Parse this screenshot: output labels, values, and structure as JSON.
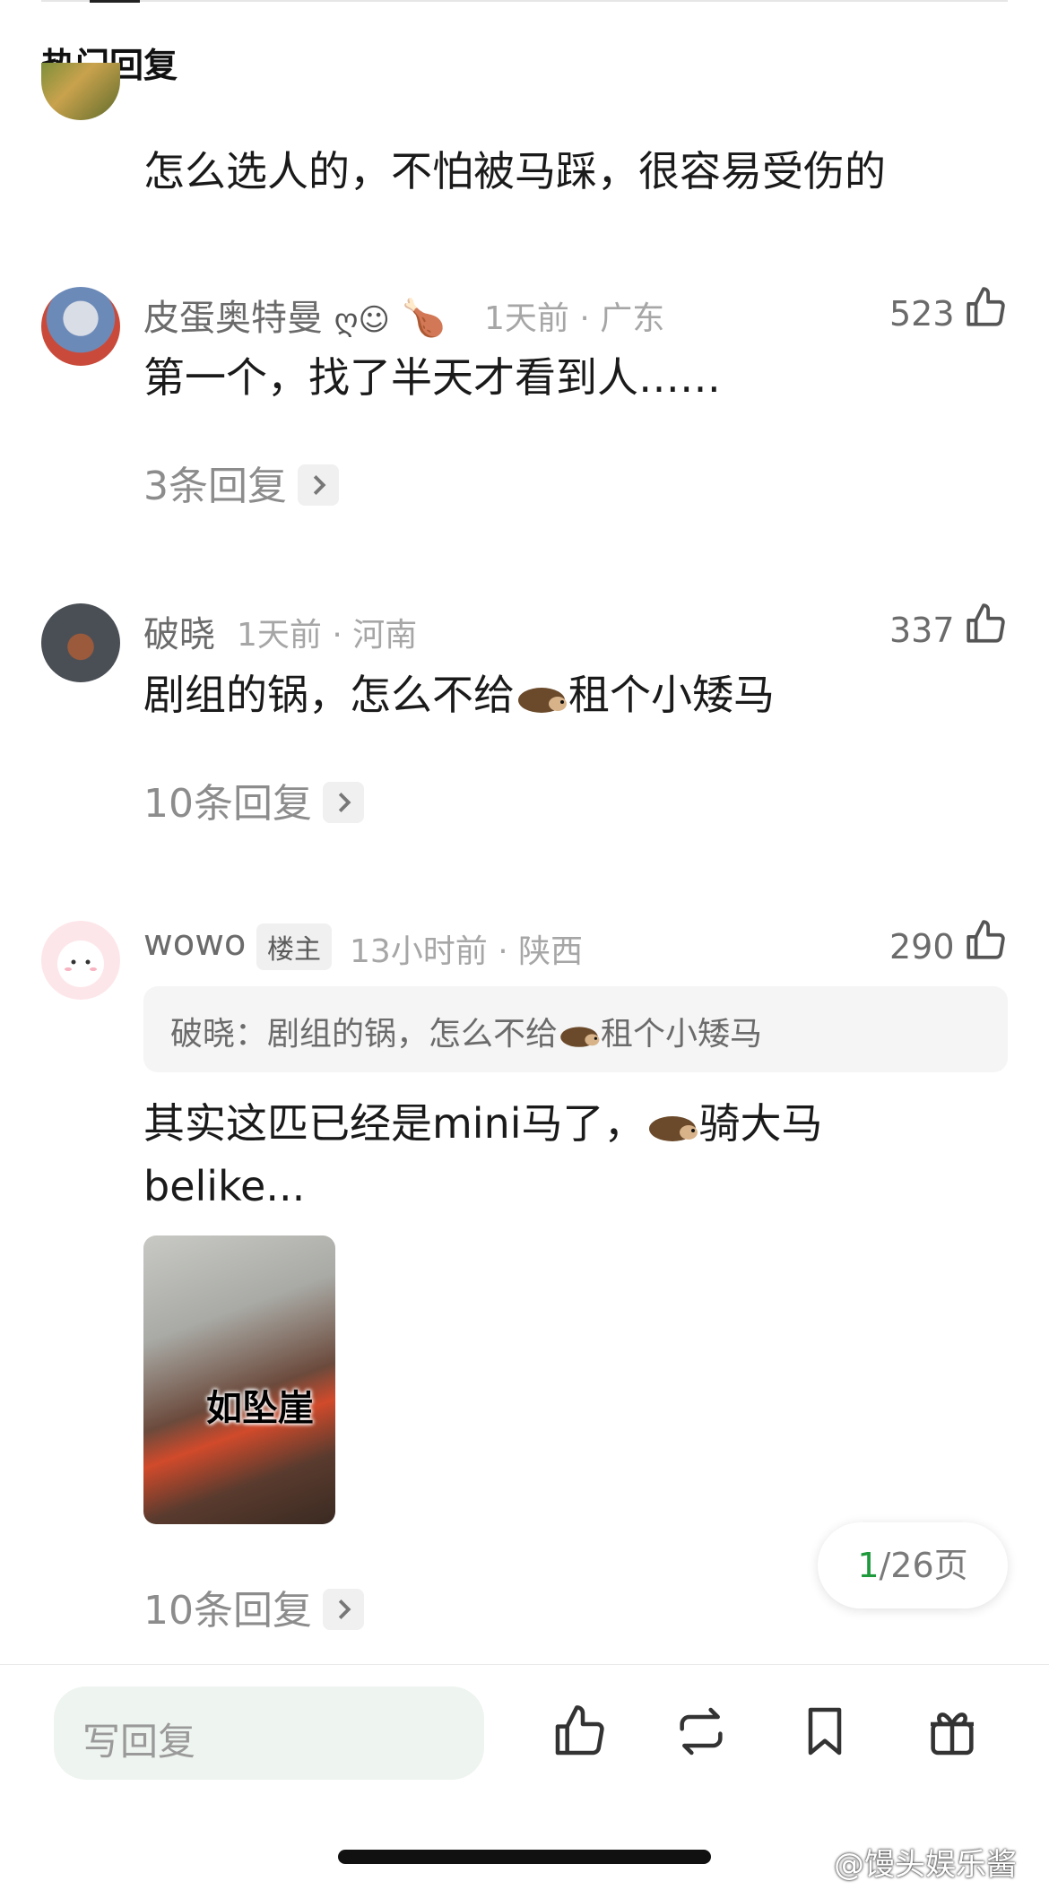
{
  "section_title": "热门回复",
  "comments": [
    {
      "text": "怎么选人的，不怕被马踩，很容易受伤的"
    },
    {
      "username": "皮蛋奥特曼",
      "badge_glyphs": "ღ☺",
      "emoji": "🍗",
      "meta": "1天前 · 广东",
      "likes": "523",
      "text": "第一个，找了半天才看到人……",
      "replies": "3条回复"
    },
    {
      "username": "破晓",
      "meta": "1天前 · 河南",
      "likes": "337",
      "text_before": "剧组的锅，怎么不给",
      "text_after": "租个小矮马",
      "replies": "10条回复"
    },
    {
      "username": "wowo",
      "op_badge": "楼主",
      "meta": "13小时前 · 陕西",
      "likes": "290",
      "quote_before": "破晓：剧组的锅，怎么不给",
      "quote_after": "租个小矮马",
      "text_line1_before": "其实这匹已经是mini马了，",
      "text_line1_after": "骑大马",
      "text_line2": "belike...",
      "image_caption": "如坠崖",
      "replies": "10条回复"
    }
  ],
  "pager": {
    "current": "1",
    "rest": "/26页"
  },
  "bottom_bar": {
    "placeholder": "写回复",
    "icons": [
      "thumbs-up-icon",
      "repost-icon",
      "bookmark-icon",
      "gift-icon"
    ]
  },
  "watermark": "@馒头娱乐酱",
  "colors": {
    "accent_green": "#1e9a3c",
    "input_bg": "#eef4ef"
  }
}
